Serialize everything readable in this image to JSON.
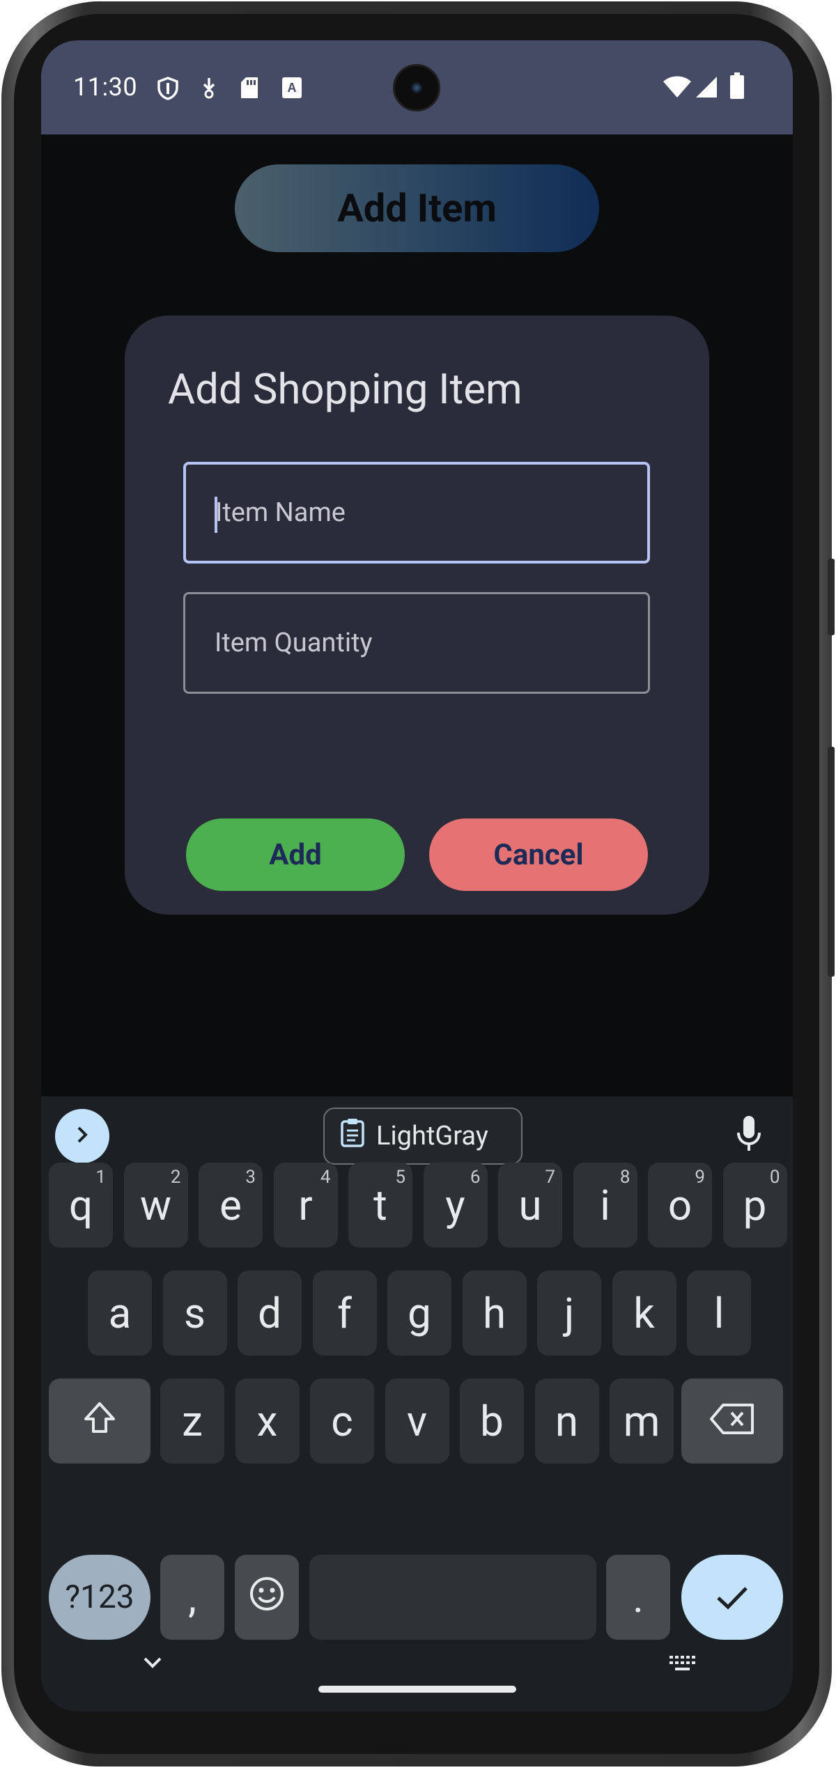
{
  "status_bar": {
    "time": "11:30",
    "left_icons": [
      "shield-icon",
      "download-icon",
      "sd-card-icon",
      "font-a-icon"
    ],
    "right_icons": [
      "wifi-icon",
      "signal-icon",
      "battery-icon"
    ]
  },
  "app": {
    "add_item_button_label": "Add Item",
    "add_item_button_gradient": [
      "#4b5f6b",
      "#0f2d56"
    ]
  },
  "dialog": {
    "title": "Add Shopping Item",
    "item_name_placeholder": "Item Name",
    "item_quantity_placeholder": "Item Quantity",
    "add_label": "Add",
    "cancel_label": "Cancel",
    "add_color": "#4caf50",
    "cancel_color": "#e57373"
  },
  "keyboard": {
    "clipboard_suggestion": "LightGray",
    "rows": [
      [
        {
          "label": "q",
          "hint": "1"
        },
        {
          "label": "w",
          "hint": "2"
        },
        {
          "label": "e",
          "hint": "3"
        },
        {
          "label": "r",
          "hint": "4"
        },
        {
          "label": "t",
          "hint": "5"
        },
        {
          "label": "y",
          "hint": "6"
        },
        {
          "label": "u",
          "hint": "7"
        },
        {
          "label": "i",
          "hint": "8"
        },
        {
          "label": "o",
          "hint": "9"
        },
        {
          "label": "p",
          "hint": "0"
        }
      ],
      [
        {
          "label": "a"
        },
        {
          "label": "s"
        },
        {
          "label": "d"
        },
        {
          "label": "f"
        },
        {
          "label": "g"
        },
        {
          "label": "h"
        },
        {
          "label": "j"
        },
        {
          "label": "k"
        },
        {
          "label": "l"
        }
      ],
      [
        {
          "label": "z"
        },
        {
          "label": "x"
        },
        {
          "label": "c"
        },
        {
          "label": "v"
        },
        {
          "label": "b"
        },
        {
          "label": "n"
        },
        {
          "label": "m"
        }
      ]
    ],
    "symbols_label": "?123",
    "comma_label": ",",
    "period_label": "."
  }
}
